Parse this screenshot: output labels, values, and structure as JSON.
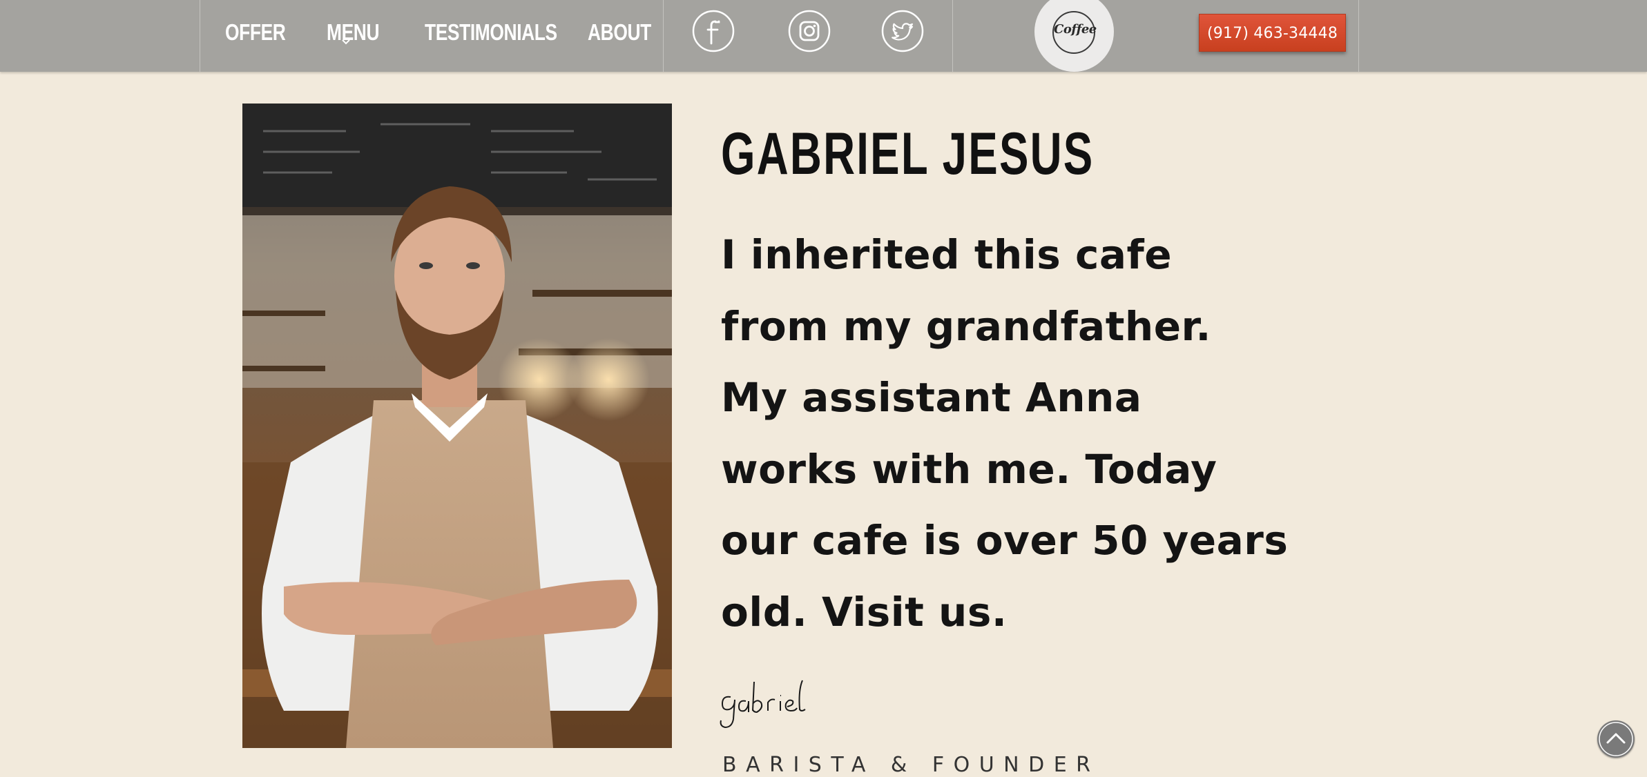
{
  "nav": {
    "items": [
      {
        "label": "OFFER"
      },
      {
        "label": "MENU"
      },
      {
        "label": "TESTIMONIALS"
      },
      {
        "label": "ABOUT"
      }
    ]
  },
  "social": [
    {
      "icon": "facebook-icon"
    },
    {
      "icon": "instagram-icon"
    },
    {
      "icon": "twitter-icon"
    }
  ],
  "logo": {
    "text": "Coffee",
    "icon": "coffee-logo"
  },
  "phone_button": {
    "label": "(917) 463-34448"
  },
  "profile": {
    "name": "GABRIEL JESUS",
    "quote_lines": [
      "I inherited this cafe",
      "from my grandfather.",
      "My assistant Anna",
      "works with me. Today",
      "our cafe is over 50 years",
      "old. Visit us."
    ],
    "signature": "gabriel",
    "role": "BARISTA & FOUNDER"
  },
  "colors": {
    "header_bg": "#a4a39f",
    "page_bg": "#f2eadc",
    "accent": "#d44a2c"
  },
  "scroll_top": {
    "icon": "chevron-up-icon"
  }
}
